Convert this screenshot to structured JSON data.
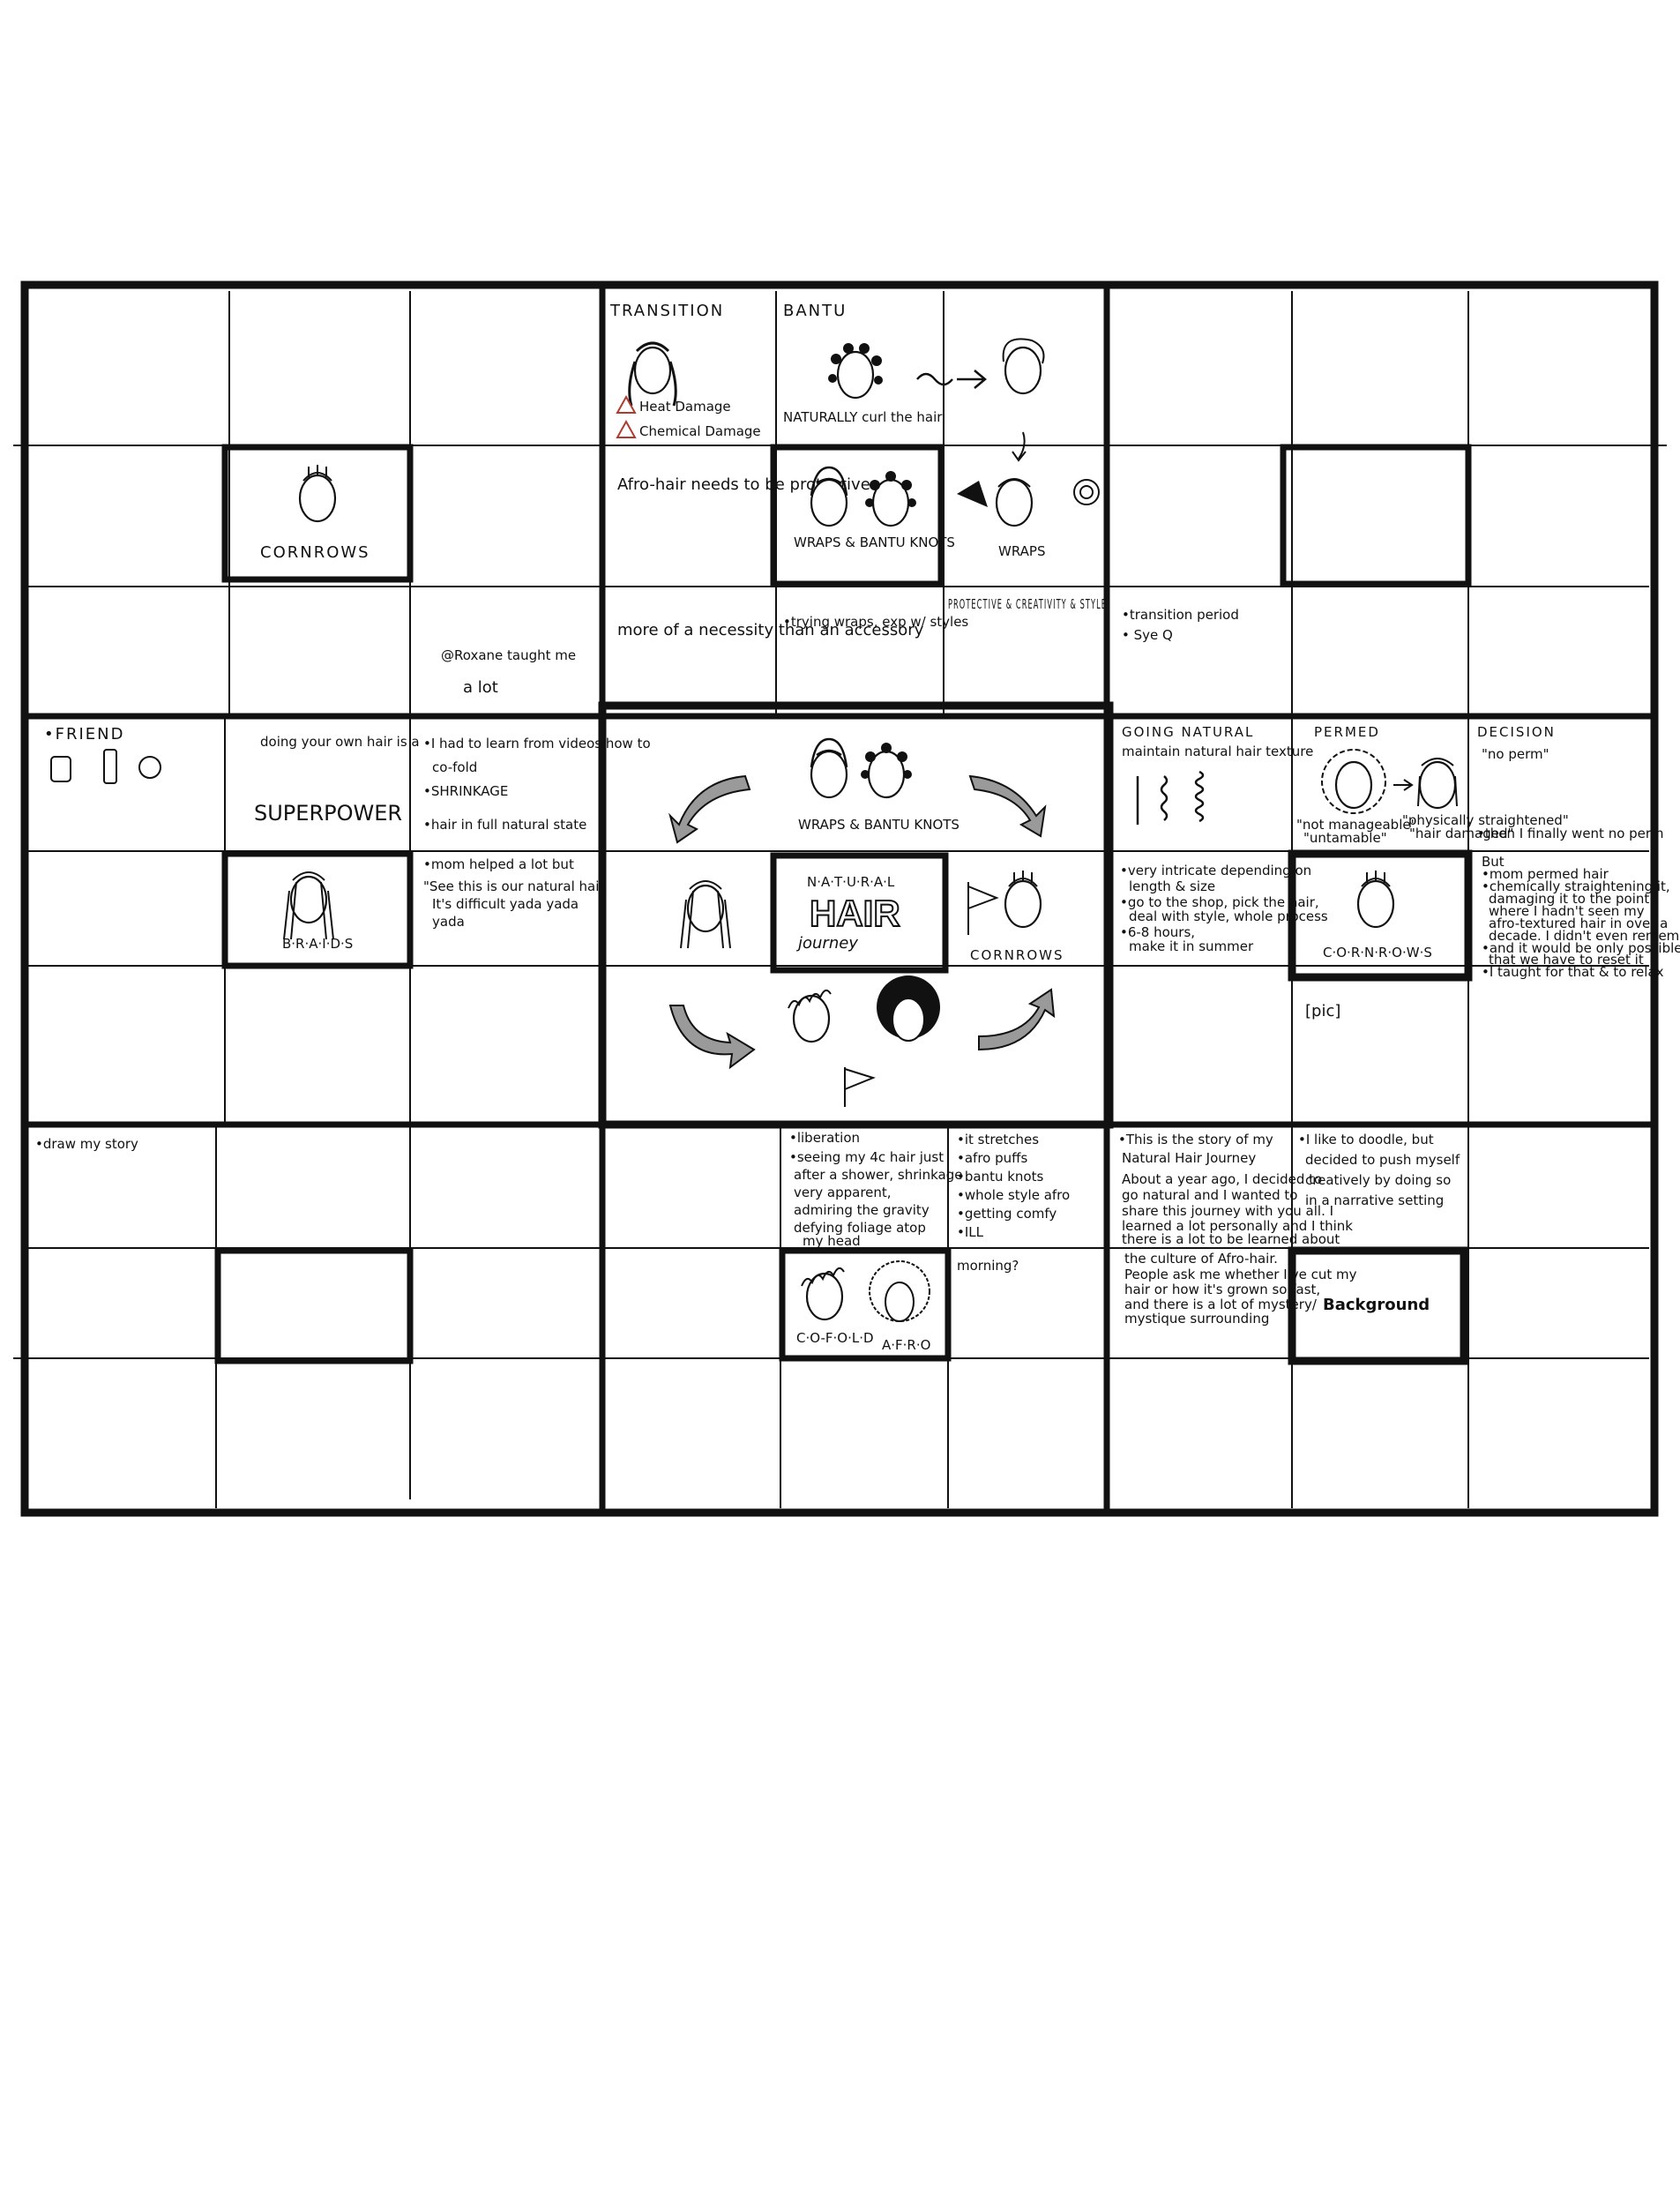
{
  "board": {
    "top_left": {
      "cornrows_label": "CORNROWS",
      "note_roxane": "@Roxane taught me",
      "note_alot": "a lot"
    },
    "top_center": {
      "transition_title": "TRANSITION",
      "transition_notes": [
        "Heat Damage",
        "Chemical Damage"
      ],
      "bantu_title": "BANTU",
      "bantu_caption": "NATURALLY curl the hair",
      "afro_hair_note": "Afro-hair needs to be protective",
      "wraps_bantu_label": "WRAPS & BANTU KNOTS",
      "wraps_label": "WRAPS",
      "necessity_note": "more of a necessity than an accessory",
      "trying_wraps_note": "•trying wraps, exp w/ styles",
      "protective_note": "PROTECTIVE & CREATIVITY & STYLE"
    },
    "top_right": {
      "transition_notes": [
        "•transition period",
        "• Sye Q"
      ]
    },
    "middle_left": {
      "friend_title": "•FRIEND",
      "superpower_note": "doing your own hair is a",
      "superpower_word": "SUPERPOWER",
      "learn_notes": [
        "•I had to learn from videos how to",
        "co-fold",
        "•SHRINKAGE",
        "•hair in full natural state"
      ],
      "braids_label": "B·R·A·I·D·S",
      "mom_notes": [
        "•mom helped a lot but",
        "\"See this is our natural hair.",
        "It's difficult yada yada",
        "yada"
      ]
    },
    "center": {
      "wraps_bantu_label": "WRAPS & BANTU KNOTS",
      "title_top": "N·A·T·U·R·A·L",
      "title_main": "HAIR",
      "title_bottom": "journey",
      "cornrows_label": "CORNROWS"
    },
    "middle_right": {
      "going_natural_title": "GOING NATURAL",
      "going_natural_note": "maintain natural hair texture",
      "permed_title": "PERMED",
      "permed_captions": [
        "\"not manageable\"",
        "\"untamable\"",
        "\"physically straightened\"",
        "\"hair damaged\""
      ],
      "decision_title": "DECISION",
      "decision_note": "\"no perm\"",
      "final_note": "•then I finally went no perm",
      "intricate_notes": [
        "•very intricate depending on",
        "length & size",
        "•go to the shop, pick the hair,",
        "deal with style, whole process",
        "•6-8 hours,",
        "make it in summer"
      ],
      "cornrows_label": "C·O·R·N·R·O·W·S",
      "pic_label": "[pic]",
      "but_notes": [
        "But",
        "•mom permed hair",
        "•chemically straightening it,",
        "damaging it to the point",
        "where I hadn't seen my",
        "afro-textured hair in over a",
        "decade. I didn't even remember",
        "•and it would be only possible to grow",
        "that we have to reset it",
        "•I taught for that & to relax"
      ]
    },
    "bottom_left": {
      "draw_story_note": "•draw my story"
    },
    "bottom_center": {
      "liberation_notes": [
        "•liberation",
        "•seeing my 4c hair just",
        "after a shower, shrinkage",
        "very apparent,",
        "admiring the gravity",
        "defying foliage atop",
        "my head"
      ],
      "style_notes": [
        "•it stretches",
        "•afro puffs",
        "•bantu knots",
        "•whole style afro",
        "•getting comfy",
        "•ILL"
      ],
      "morning_note": "morning?",
      "cofold_label": "C·O-F·O·L·D",
      "afro_label": "A·F·R·O"
    },
    "bottom_right": {
      "story_title": "•This is the story of my",
      "story_title2": "Natural Hair Journey",
      "story_lines": [
        "About a year ago, I decided to",
        "go natural and I wanted to",
        "share this journey with you all. I",
        "learned a lot personally and I think",
        "there is a lot to be learned about"
      ],
      "culture_lines": [
        "the culture of Afro-hair.",
        "People ask me whether I've cut my",
        "hair or how it's grown so fast,",
        "and there is a lot of mystery/",
        "mystique surrounding"
      ],
      "doodle_lines": [
        "•I like to doodle, but",
        "decided to push myself",
        "creatively by doing so",
        "in a narrative setting"
      ],
      "background_label": "Background"
    }
  },
  "colors": {
    "ink": "#111111",
    "warning": "#b03a2e",
    "arrow_fill": "#9a9a9a"
  }
}
